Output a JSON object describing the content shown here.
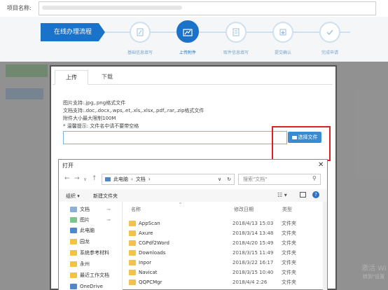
{
  "header": {
    "project_label": "项目名称:"
  },
  "flow": {
    "banner": "在线办理流程",
    "steps": [
      {
        "label": "基础信息填写"
      },
      {
        "label": "上传附件"
      },
      {
        "label": "取件信息填写"
      },
      {
        "label": "提交确认"
      },
      {
        "label": "完成申请"
      }
    ]
  },
  "modal": {
    "tabs": [
      "上传",
      "下载"
    ],
    "info": [
      "图片支持:.jpg,.png格式文件",
      "文档支持:.doc,.docx,.wps,.et,.xls,.xlsx,.pdf,.rar,.zip格式文件",
      "附件大小最大限制100M",
      "* 温馨提示: 文件名中请不要带空格"
    ],
    "choose_label": "选择文件"
  },
  "file_dialog": {
    "title": "打开",
    "close": "✕",
    "address": [
      "此电脑",
      "文档"
    ],
    "search_placeholder": "搜索\"文档\"",
    "organize": "组织 ▾",
    "new_folder": "新建文件夹",
    "sidebar": [
      {
        "label": "文档",
        "kind": "doc"
      },
      {
        "label": "图片",
        "kind": "pic"
      },
      {
        "label": "此电脑",
        "kind": "pc"
      },
      {
        "label": "园龙",
        "kind": "folder"
      },
      {
        "label": "系统参考材料",
        "kind": "folder"
      },
      {
        "label": "永州",
        "kind": "folder"
      },
      {
        "label": "最近工作文档",
        "kind": "folder"
      },
      {
        "label": "OneDrive",
        "kind": "pc"
      }
    ],
    "columns": {
      "name": "名称",
      "date": "修改日期",
      "type": "类型"
    },
    "rows": [
      {
        "name": "AppScan",
        "date": "2018/4/13 15:03",
        "type": "文件夹"
      },
      {
        "name": "Axure",
        "date": "2018/3/14 13:48",
        "type": "文件夹"
      },
      {
        "name": "CGPdf2Word",
        "date": "2018/4/20 15:49",
        "type": "文件夹"
      },
      {
        "name": "Downloads",
        "date": "2018/3/15 11:49",
        "type": "文件夹"
      },
      {
        "name": "Inpor",
        "date": "2018/3/22 16:17",
        "type": "文件夹"
      },
      {
        "name": "Navicat",
        "date": "2018/3/15 10:40",
        "type": "文件夹"
      },
      {
        "name": "QQPCMgr",
        "date": "2018/4/4 2:26",
        "type": "文件夹"
      }
    ]
  },
  "watermark": {
    "line1": "激活 Wi",
    "line2": "转到\"设置"
  }
}
